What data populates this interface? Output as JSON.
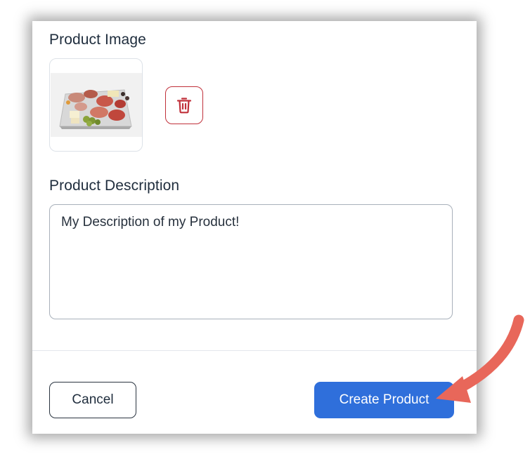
{
  "product_image": {
    "label": "Product Image",
    "thumbnail": "charcuterie-platter",
    "delete_icon": "trash-icon"
  },
  "product_description": {
    "label": "Product Description",
    "value": "My Description of my Product!"
  },
  "footer": {
    "cancel_label": "Cancel",
    "create_label": "Create Product"
  },
  "colors": {
    "primary": "#2f6fdb",
    "danger": "#c0303a",
    "annotation_arrow": "#e8675a",
    "text": "#1f2d3d"
  }
}
